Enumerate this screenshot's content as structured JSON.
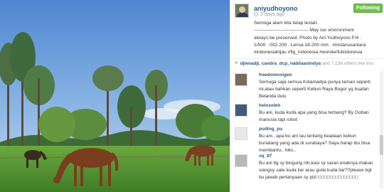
{
  "post": {
    "username": "aniyudhoyono",
    "time_ago": "3 days ago",
    "follow_label": "Following",
    "caption": [
      "Semoga alam kita tetap lestari.",
      "----------------------------------- May our environment",
      "always be preserved. Photo by Ani Yudhoyono F/4 .",
      "1/500 . ISO 200 . Lensa 18-200 mm . #instanusantara",
      "#indonesiahijau #fig_indonesia #wonderfulindonesia"
    ]
  },
  "likes": {
    "names": "djienadji, candra_dcp, nabilaanindya",
    "rest": " and 7,136 others like this"
  },
  "comments": [
    {
      "user": "freedomoxigen",
      "text": "Semoga saja semua Kotamadya punya taman seperti ini,atau bahkan seperti Kebun Raya Bogor yg buatan Belanda dulu",
      "avatar_color": "#7a6a5a"
    },
    {
      "user": "helosoleh",
      "text": "Bu ani, kuda kuda apa yang bisa terbang? By Goban manusia tapi robot",
      "avatar_color": "#3f5c7a"
    },
    {
      "user": "puding_pu",
      "text": "Bu ani.. apa bu ani tau tentang keadaan kebun bunatang yang ada di surabaya? Saya harap ibu bisa membantu.. hiks..",
      "avatar_color": "#e8e8e8"
    },
    {
      "user": "vq_87",
      "text": "Bu ani tlg sy bingung nih,kasi sy saran enaknya makan siangsy sate kuda liar arau gulai kuda liar??please bgt bu jawab pertanyaan sy plz□□□□□□□□□□□□□□□",
      "avatar_color": "#b8b8b8"
    }
  ],
  "colors": {
    "link": "#2b5a83",
    "follow_bg": "#70c050",
    "sky": "#6f9fd8",
    "grass": "#5a9a3a"
  },
  "icons": {
    "likes": "heart-icon",
    "time": "clock-icon"
  }
}
